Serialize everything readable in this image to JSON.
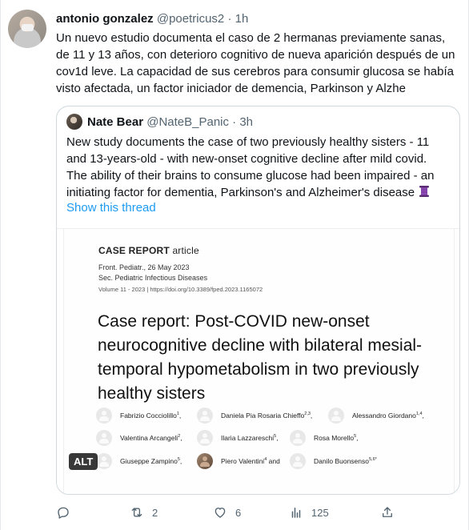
{
  "tweet": {
    "author_name": "antonio gonzalez",
    "author_handle": "@poetricus2",
    "separator": "·",
    "time": "1h",
    "text": "Un nuevo estudio documenta el caso de 2 hermanas previamente sanas, de 11 y 13 años, con deterioro cognitivo de nueva aparición después de un cov1d leve. La capacidad de sus cerebros para consumir glucosa se había visto afectada, un factor iniciador de demencia, Parkinson y Alzhe"
  },
  "quote": {
    "author_name": "Nate Bear",
    "author_handle": "@NateB_Panic",
    "separator": "·",
    "time": "3h",
    "text": "New study documents the case of two previously healthy sisters - 11 and 13-years-old - with new-onset cognitive decline after mild covid. The ability of their brains to consume glucose had been impaired - an initiating factor for dementia, Parkinson's and Alzheimer's disease",
    "show_thread": "Show this thread"
  },
  "paper": {
    "label_main": "CASE REPORT",
    "label_suffix": "article",
    "journal_line": "Front. Pediatr., 26 May 2023",
    "section_line": "Sec. Pediatric Infectious Diseases",
    "volume_line": "Volume 11 - 2023 | https://doi.org/10.3389/fped.2023.1165072",
    "title": "Case report: Post-COVID new-onset neurocognitive decline with bilateral mesial-temporal hypometabolism in two previously healthy sisters",
    "authors": [
      {
        "name": "Fabrizio Cocciolillo",
        "sup": "1"
      },
      {
        "name": "Daniela Pia Rosaria Chieffo",
        "sup": "2,3"
      },
      {
        "name": "Alessandro Giordano",
        "sup": "1,4"
      },
      {
        "name": "Valentina Arcangeli",
        "sup": "2"
      },
      {
        "name": "Ilaria Lazzareschi",
        "sup": "5"
      },
      {
        "name": "Rosa Morello",
        "sup": "5"
      },
      {
        "name": "Giuseppe Zampino",
        "sup": "5"
      },
      {
        "name": "Piero Valentini",
        "sup": "4"
      },
      {
        "name": "Danilo Buonsenso",
        "sup": "5,6*"
      }
    ],
    "and_word": "and"
  },
  "media": {
    "alt_badge": "ALT"
  },
  "actions": {
    "reply_count": "",
    "retweet_count": "2",
    "like_count": "6",
    "views_count": "125"
  },
  "icons": {
    "reply": "reply-icon",
    "retweet": "retweet-icon",
    "like": "heart-icon",
    "views": "analytics-icon",
    "share": "share-icon",
    "thread_emoji": "thread-spool-emoji"
  },
  "colors": {
    "link": "#1d9bf0",
    "muted": "#536471",
    "text": "#0f1419",
    "border": "#cfd9de",
    "emoji": "#7b3f9e"
  }
}
